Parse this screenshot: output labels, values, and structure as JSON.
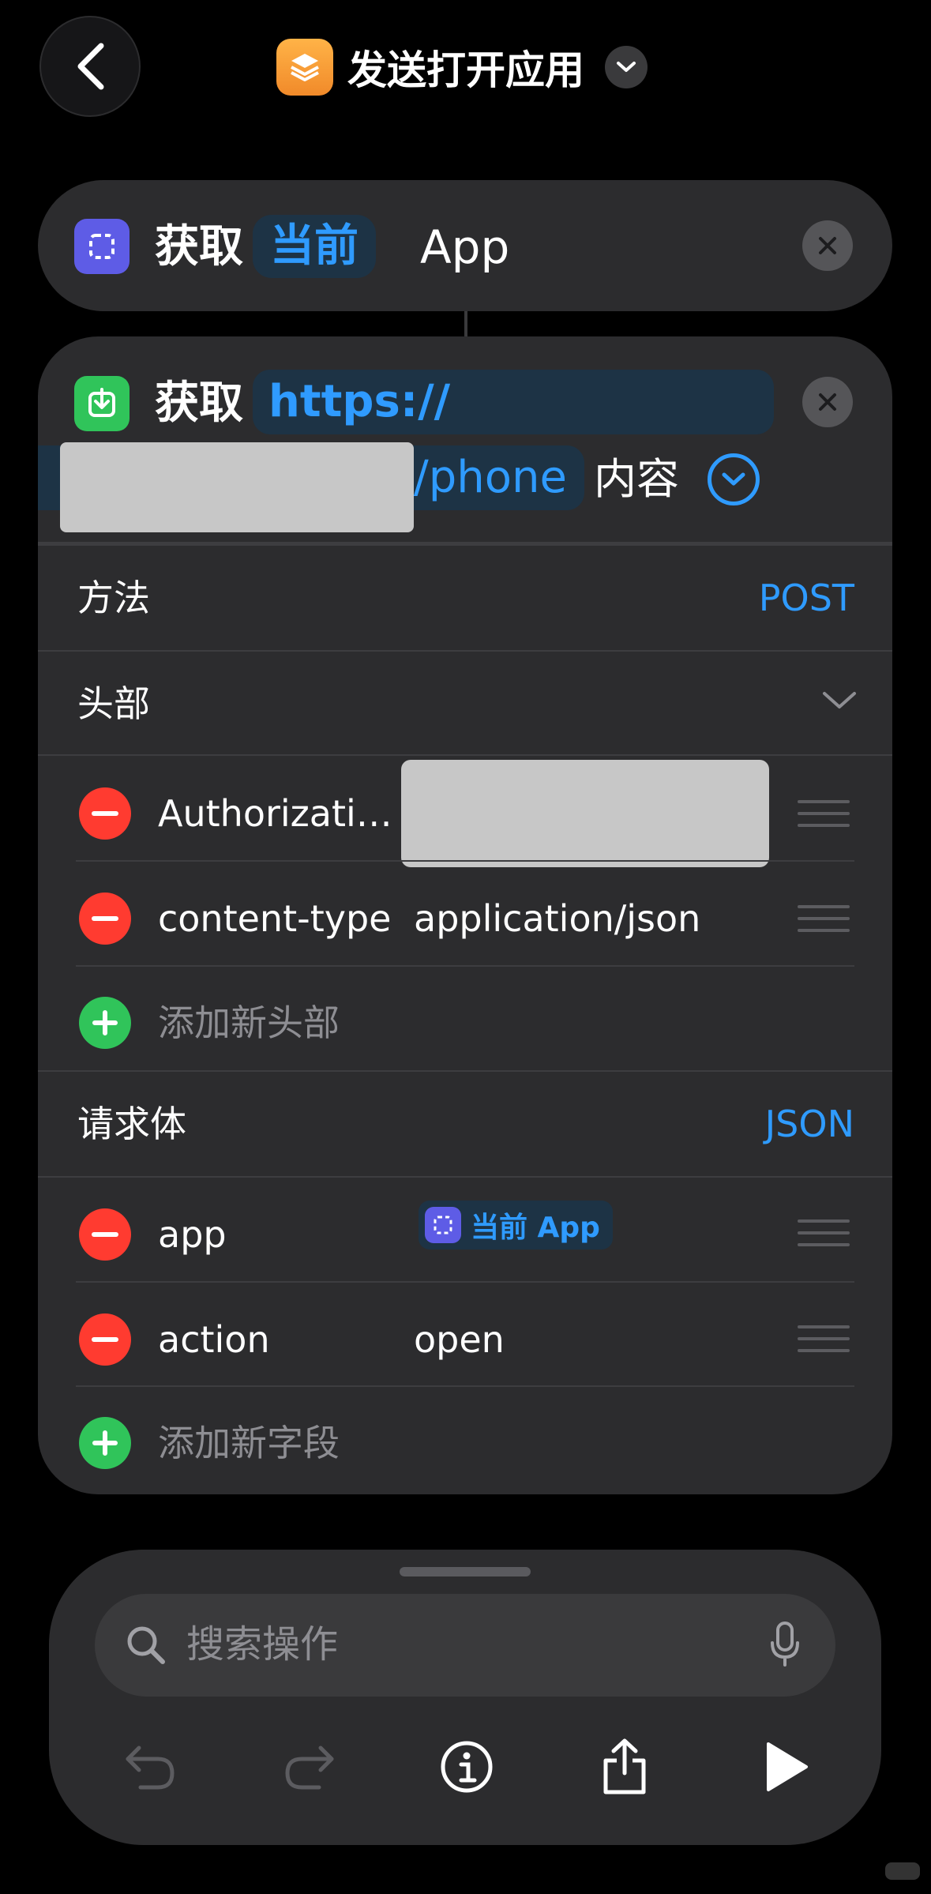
{
  "header": {
    "title": "发送打开应用",
    "icon": "shortcuts-layers-icon"
  },
  "action_get_app": {
    "verb": "获取",
    "variable": "当前",
    "object": "App"
  },
  "action_fetch": {
    "verb": "获取",
    "url_part1": "https://",
    "url_part2": "e/phone",
    "suffix": "内容",
    "method_label": "方法",
    "method_value": "POST",
    "headers_label": "头部",
    "headers": [
      {
        "key": "Authorizati…",
        "value": ""
      },
      {
        "key": "content-type",
        "value": "application/json"
      }
    ],
    "add_header_label": "添加新头部",
    "body_label": "请求体",
    "body_type": "JSON",
    "body_fields": [
      {
        "key": "app",
        "value": "当前 App"
      },
      {
        "key": "action",
        "value": "open"
      }
    ],
    "add_field_label": "添加新字段"
  },
  "bottom_sheet": {
    "search_placeholder": "搜索操作"
  },
  "colors": {
    "accent": "#2f9bff",
    "background": "#000000",
    "card": "#2c2c2e",
    "delete": "#ff3b30",
    "add": "#30c45a",
    "app_icon": "#5e5ce6"
  }
}
